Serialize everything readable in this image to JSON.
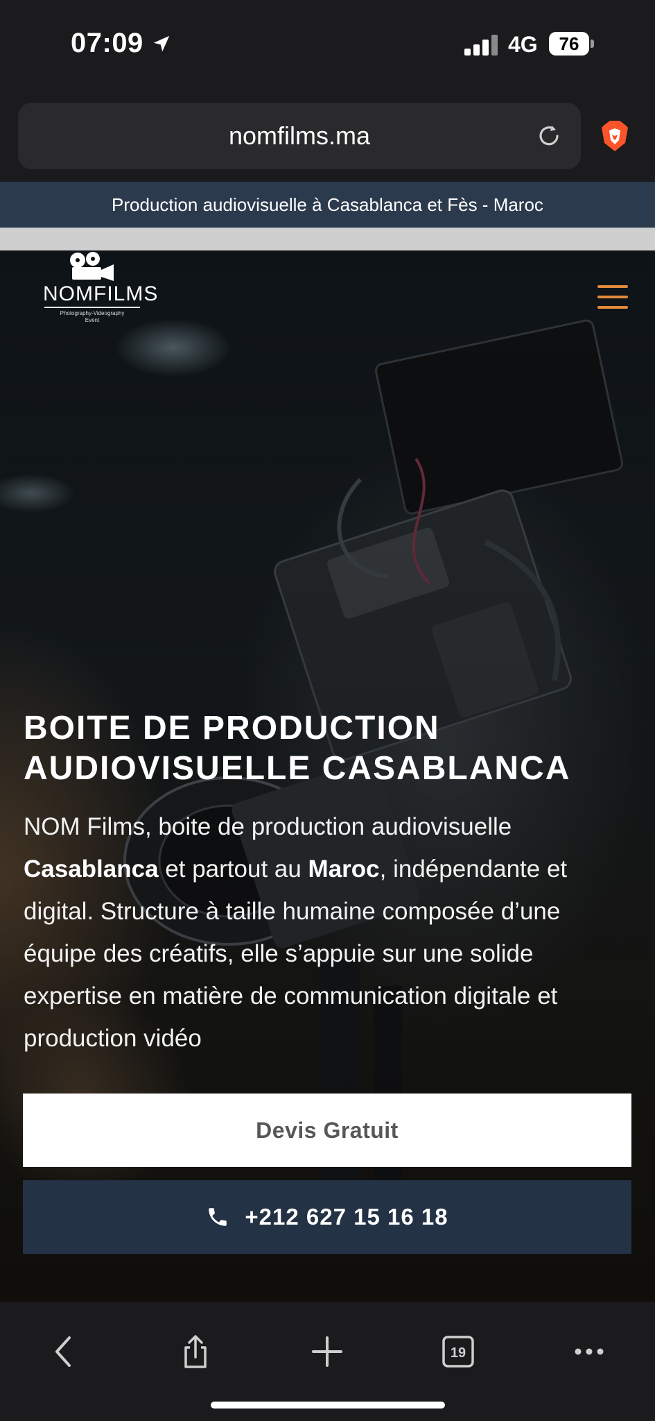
{
  "status": {
    "time": "07:09",
    "network": "4G",
    "battery": "76"
  },
  "browser": {
    "url": "nomfilms.ma",
    "tab_count": "19"
  },
  "banner": {
    "text": "Production audiovisuelle à Casablanca et Fès - Maroc"
  },
  "logo": {
    "word": "NOMFILMS",
    "subtitle_1": "Photography-Videography",
    "subtitle_2": "Event"
  },
  "hero": {
    "headline_1": "BOITE DE PRODUCTION",
    "headline_2": "AUDIOVISUELLE CASABLANCA",
    "para_1": "NOM Films, boite de production audiovisuelle ",
    "para_bold_1": "Casablanca",
    "para_2": " et partout au ",
    "para_bold_2": "Maroc",
    "para_3": ", indépendante et digital. Structure à taille humaine composée d’une équipe des créatifs, elle s’appuie sur une solide expertise en matière de communication digitale et production vidéo",
    "cta_quote": "Devis Gratuit",
    "cta_phone": "+212 627 15 16 18"
  },
  "colors": {
    "banner_bg": "#2b3a4d",
    "phone_btn_bg": "#243245",
    "menu_accent": "#e08a3a"
  }
}
